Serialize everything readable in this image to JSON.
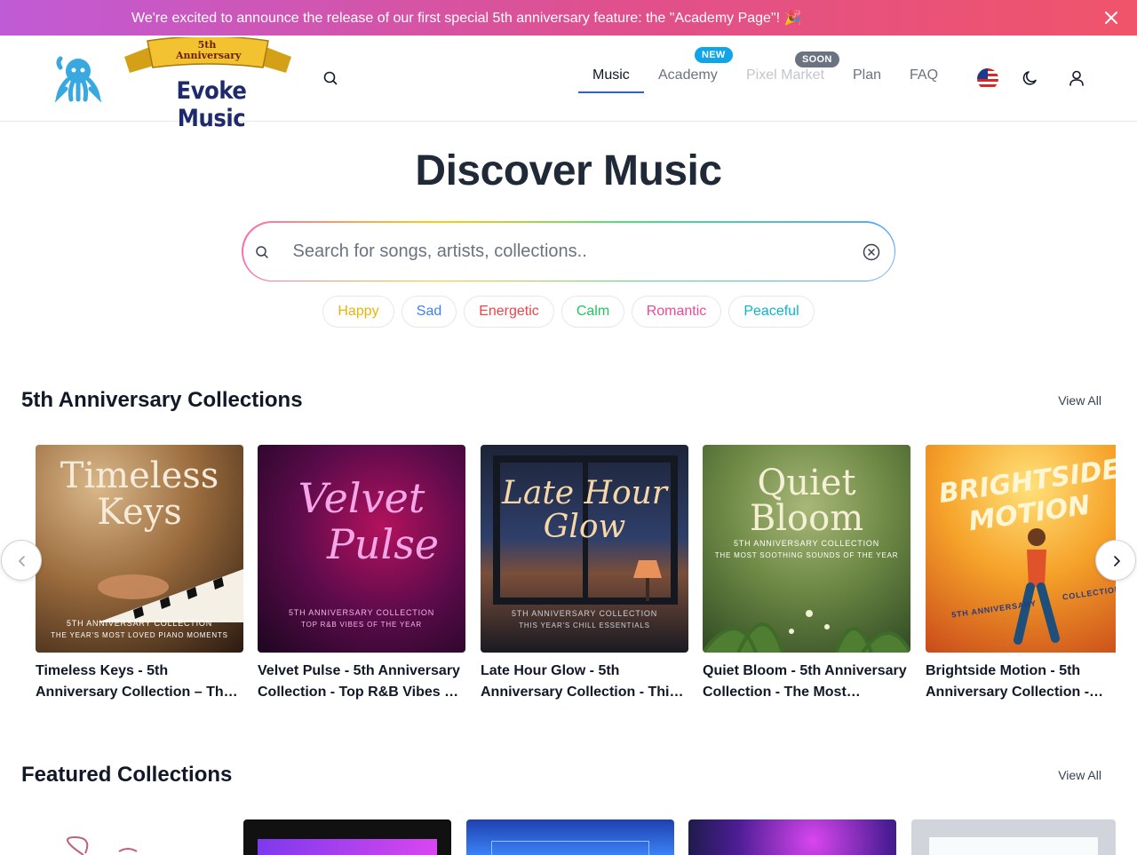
{
  "announcement": {
    "text": "We're excited to announce the release of our first special 5th anniversary feature: the \"Academy Page\"! 🎉"
  },
  "brand": {
    "anniversary": "5th Anniversary",
    "name": "Evoke Music"
  },
  "nav": {
    "items": [
      {
        "label": "Music",
        "state": "active"
      },
      {
        "label": "Academy",
        "badge": "NEW"
      },
      {
        "label": "Pixel Market",
        "badge": "SOON",
        "state": "disabled"
      },
      {
        "label": "Plan"
      },
      {
        "label": "FAQ"
      }
    ]
  },
  "hero": {
    "title": "Discover Music",
    "search_placeholder": "Search for songs, artists, collections..",
    "moods": [
      {
        "label": "Happy",
        "color": "#eab308"
      },
      {
        "label": "Sad",
        "color": "#3b82f6"
      },
      {
        "label": "Energetic",
        "color": "#ef4444"
      },
      {
        "label": "Calm",
        "color": "#22c55e"
      },
      {
        "label": "Romantic",
        "color": "#ec4899"
      },
      {
        "label": "Peaceful",
        "color": "#06b6d4"
      }
    ]
  },
  "anniversary_section": {
    "title": "5th Anniversary Collections",
    "view_all": "View All",
    "cards": [
      {
        "cover_title_1": "Timeless",
        "cover_title_2": "Keys",
        "cover_sub_1": "5TH ANNIVERSARY COLLECTION",
        "cover_sub_2": "THE YEAR'S MOST LOVED PIANO MOMENTS",
        "caption": "Timeless Keys - 5th Anniversary Collection – The Year's Most Loved Piano Moments"
      },
      {
        "cover_title_1": "Velvet",
        "cover_title_2": "Pulse",
        "cover_sub_1": "5TH ANNIVERSARY COLLECTION",
        "cover_sub_2": "TOP R&B VIBES OF THE YEAR",
        "caption": "Velvet Pulse - 5th Anniversary Collection - Top R&B Vibes of the Year"
      },
      {
        "cover_title_1": "Late Hour",
        "cover_title_2": "Glow",
        "cover_sub_1": "5TH ANNIVERSARY COLLECTION",
        "cover_sub_2": "THIS YEAR'S CHILL ESSENTIALS",
        "caption": "Late Hour Glow - 5th Anniversary Collection - This Year's Chill Essentials"
      },
      {
        "cover_title_1": "Quiet",
        "cover_title_2": "Bloom",
        "cover_sub_1": "5TH ANNIVERSARY COLLECTION",
        "cover_sub_2": "THE MOST SOOTHING SOUNDS OF THE YEAR",
        "caption": "Quiet Bloom - 5th Anniversary Collection - The Most Soothing Sounds of the Year"
      },
      {
        "cover_title_1": "BRIGHTSIDE",
        "cover_title_2": "MOTION",
        "cover_sub_1": "5TH ANNIVERSARY",
        "cover_sub_2": "COLLECTION",
        "caption": "Brightside Motion - 5th Anniversary Collection - The Year's Most Uplifting Tracks"
      }
    ]
  },
  "featured_section": {
    "title": "Featured Collections",
    "view_all": "View All"
  },
  "colors": {
    "accent": "#2563eb",
    "badge_new": "#0ea5e9",
    "badge_soon": "#6b7280"
  }
}
